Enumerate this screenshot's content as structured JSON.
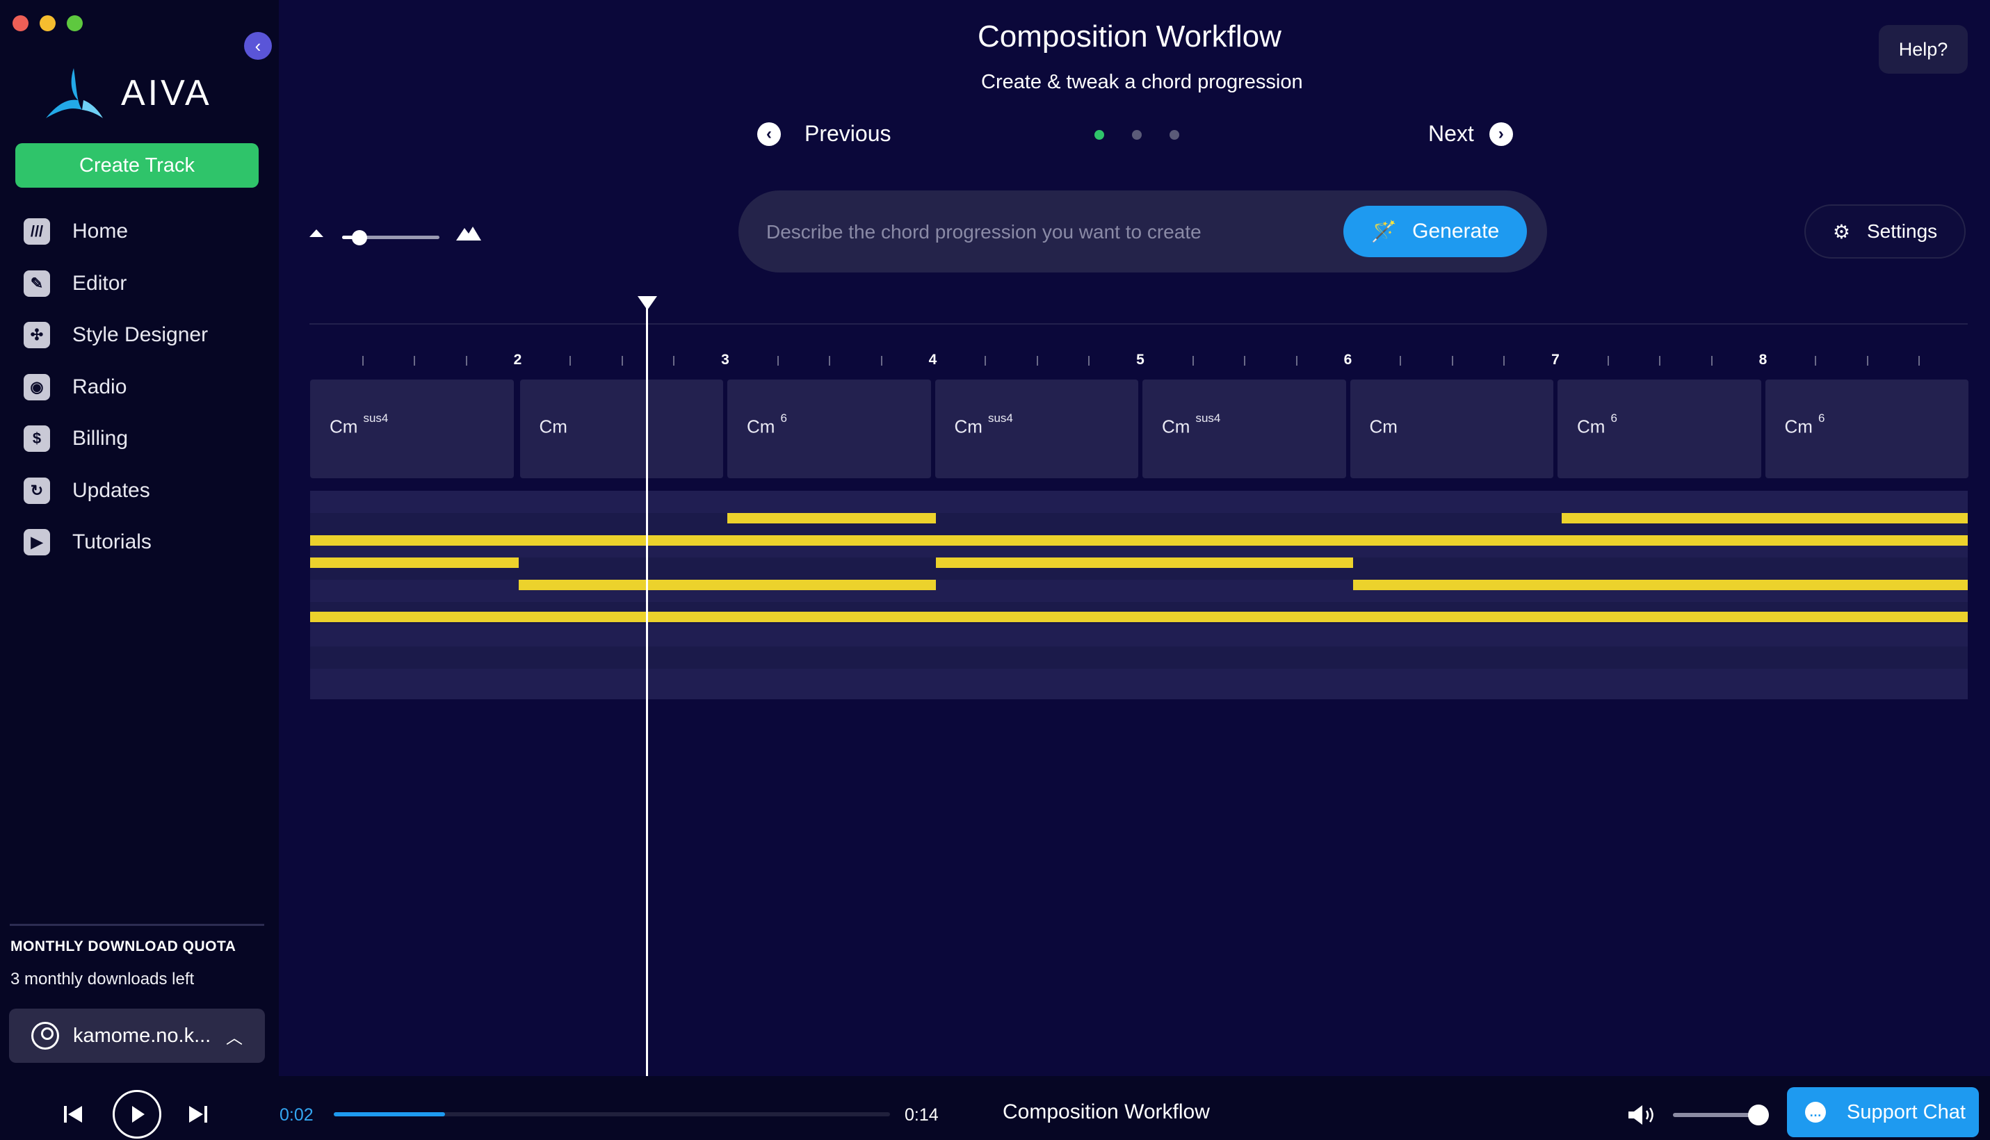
{
  "app": {
    "name": "AIVA"
  },
  "sidebar": {
    "create_label": "Create Track",
    "items": [
      {
        "label": "Home",
        "icon": "///"
      },
      {
        "label": "Editor",
        "icon": "✎"
      },
      {
        "label": "Style Designer",
        "icon": "✣"
      },
      {
        "label": "Radio",
        "icon": "◉"
      },
      {
        "label": "Billing",
        "icon": "$"
      },
      {
        "label": "Updates",
        "icon": "↻"
      },
      {
        "label": "Tutorials",
        "icon": "▶"
      }
    ],
    "quota_title": "MONTHLY DOWNLOAD QUOTA",
    "quota_text": "3 monthly downloads left",
    "user_name": "kamome.no.k..."
  },
  "header": {
    "title": "Composition Workflow",
    "subtitle": "Create & tweak a chord progression",
    "help_label": "Help?",
    "previous_label": "Previous",
    "next_label": "Next",
    "step_current": 1,
    "step_total": 3
  },
  "prompt": {
    "placeholder": "Describe the chord progression you want to create",
    "value": "",
    "generate_label": "Generate",
    "settings_label": "Settings"
  },
  "timeline": {
    "bar_numbers": [
      "2",
      "3",
      "4",
      "5",
      "6",
      "7",
      "8"
    ],
    "chords": [
      {
        "root": "Cm",
        "ext": "sus4"
      },
      {
        "root": "Cm",
        "ext": ""
      },
      {
        "root": "Cm",
        "ext": "6"
      },
      {
        "root": "Cm",
        "ext": "sus4"
      },
      {
        "root": "Cm",
        "ext": "sus4"
      },
      {
        "root": "Cm",
        "ext": ""
      },
      {
        "root": "Cm",
        "ext": "6"
      },
      {
        "root": "Cm",
        "ext": "6"
      }
    ]
  },
  "player": {
    "current_time": "0:02",
    "total_time": "0:14",
    "progress": 0.2,
    "track_name": "Composition Workflow",
    "volume": 1.0,
    "support_label": "Support Chat"
  },
  "colors": {
    "background": "#0b083a",
    "sidebar": "#060624",
    "accent_green": "#2fc46a",
    "accent_blue": "#1e9af0",
    "note_yellow": "#ecd22c"
  }
}
